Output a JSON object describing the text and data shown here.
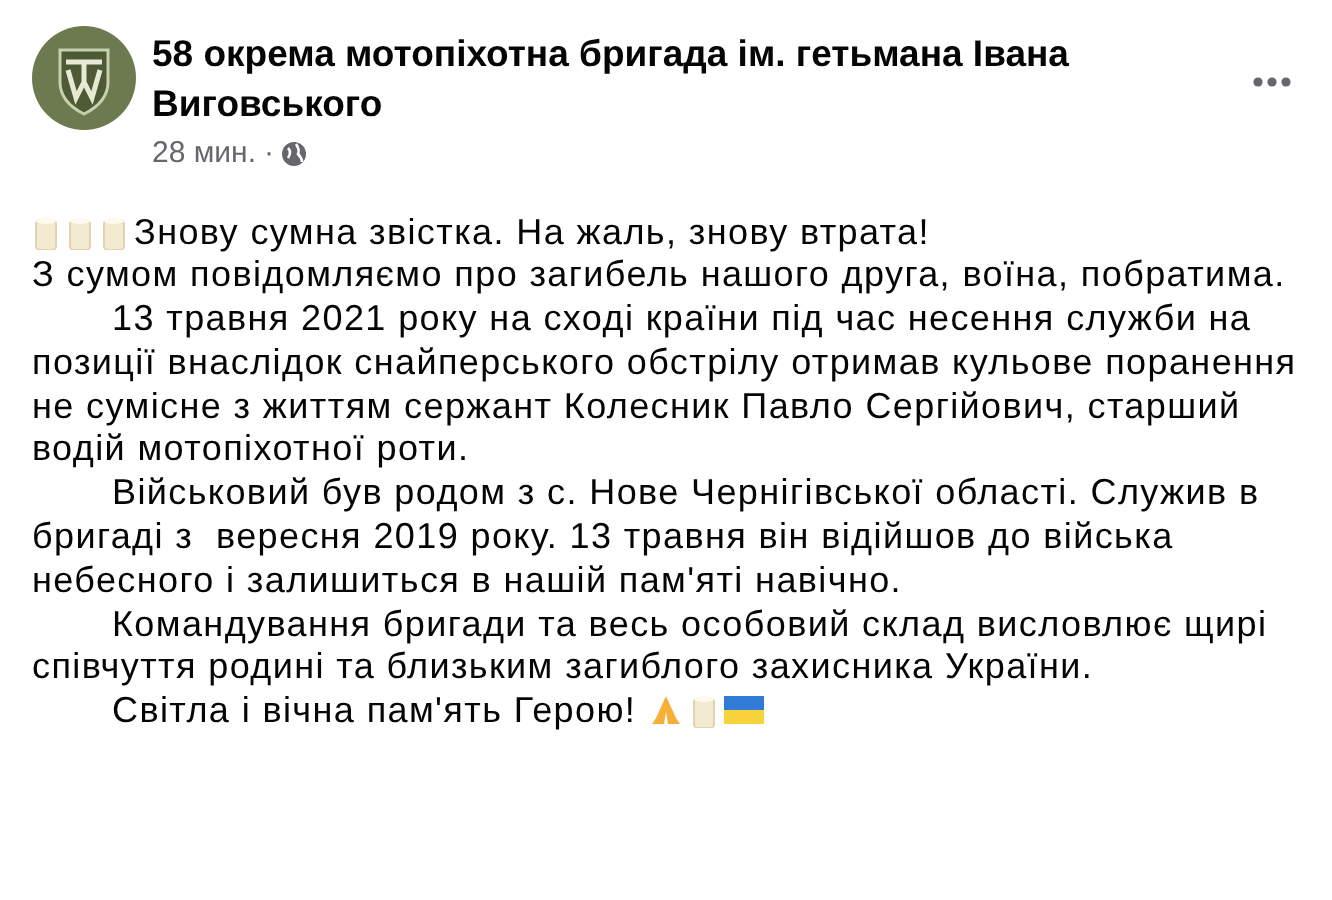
{
  "post": {
    "author": "58 окрема мотопіхотна бригада ім. гетьмана Івана Виговського",
    "time": "28 мин.",
    "separator": "·",
    "paragraphs": [
      {
        "kind": "candles",
        "text": "Знову сумна звістка. На жаль, знову втрата!"
      },
      {
        "kind": "plain",
        "text": "З сумом повідомляємо про загибель нашого друга, воїна, побратима."
      },
      {
        "kind": "indented",
        "text": "13 травня 2021 року на сході країни під час несення служби на позиції внаслідок снайперського обстрілу отримав кульове поранення не сумісне з життям сержант Колесник Павло Сергійович, старший водій мотопіхотної роти."
      },
      {
        "kind": "indented",
        "text": "Військовий був родом з с. Нове Чернігівської області. Служив в бригаді з  вересня 2019 року. 13 травня він відійшов до війська небесного і залишиться в нашій пам'яті навічно."
      },
      {
        "kind": "indented",
        "text": "Командування бригади та весь особовий склад висловлює щирі співчуття родині та близьким загиблого захисника України."
      },
      {
        "kind": "tribute",
        "text": "Світла і вічна пам'ять Герою!"
      }
    ]
  }
}
